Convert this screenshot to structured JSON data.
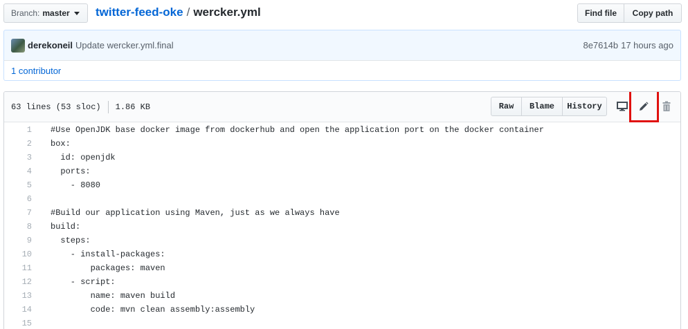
{
  "branch": {
    "label": "Branch:",
    "name": "master"
  },
  "breadcrumb": {
    "repo": "twitter-feed-oke",
    "separator": "/",
    "file": "wercker.yml"
  },
  "path_buttons": {
    "find_file": "Find file",
    "copy_path": "Copy path"
  },
  "commit": {
    "author": "derekoneil",
    "message": "Update wercker.yml.final",
    "sha": "8e7614b",
    "time": "17 hours ago"
  },
  "contributors": {
    "label": "1 contributor"
  },
  "file_info": {
    "lines": "63 lines (53 sloc)",
    "size": "1.86 KB"
  },
  "file_buttons": {
    "raw": "Raw",
    "blame": "Blame",
    "history": "History"
  },
  "icons": {
    "desktop": "desktop-icon",
    "edit": "pencil-icon",
    "delete": "trash-icon"
  },
  "highlight_color": "#e0110f",
  "code_lines": [
    {
      "num": "1",
      "text": "#Use OpenJDK base docker image from dockerhub and open the application port on the docker container"
    },
    {
      "num": "2",
      "text": "box:"
    },
    {
      "num": "3",
      "text": "  id: openjdk"
    },
    {
      "num": "4",
      "text": "  ports:"
    },
    {
      "num": "5",
      "text": "    - 8080"
    },
    {
      "num": "6",
      "text": ""
    },
    {
      "num": "7",
      "text": "#Build our application using Maven, just as we always have"
    },
    {
      "num": "8",
      "text": "build:"
    },
    {
      "num": "9",
      "text": "  steps:"
    },
    {
      "num": "10",
      "text": "    - install-packages:"
    },
    {
      "num": "11",
      "text": "        packages: maven"
    },
    {
      "num": "12",
      "text": "    - script:"
    },
    {
      "num": "13",
      "text": "        name: maven build"
    },
    {
      "num": "14",
      "text": "        code: mvn clean assembly:assembly"
    },
    {
      "num": "15",
      "text": ""
    }
  ]
}
